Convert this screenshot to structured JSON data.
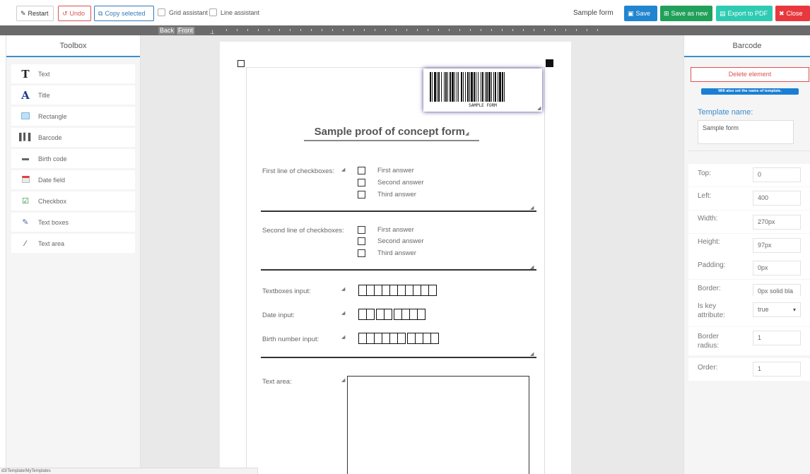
{
  "toolbar": {
    "restart_label": "Restart",
    "undo_label": "Undo",
    "copy_label": "Copy selected",
    "grid_assistant_label": "Grid assistant",
    "line_assistant_label": "Line assistant",
    "form_name": "Sample form",
    "save_label": "Save",
    "save_as_new_label": "Save as new",
    "export_label": "Export to PDF",
    "close_label": "Close"
  },
  "ruler": {
    "back_label": "Back",
    "front_label": "Front"
  },
  "toolbox": {
    "title": "Toolbox",
    "items": [
      {
        "label": "Text",
        "icon": "text-icon"
      },
      {
        "label": "Title",
        "icon": "title-icon"
      },
      {
        "label": "Rectangle",
        "icon": "rectangle-icon"
      },
      {
        "label": "Barcode",
        "icon": "barcode-icon"
      },
      {
        "label": "Birth code",
        "icon": "birth-code-icon"
      },
      {
        "label": "Date field",
        "icon": "calendar-icon"
      },
      {
        "label": "Checkbox",
        "icon": "checkbox-icon"
      },
      {
        "label": "Text boxes",
        "icon": "text-boxes-icon"
      },
      {
        "label": "Text area",
        "icon": "text-area-icon"
      }
    ]
  },
  "form": {
    "barcode_text": "SAMPLE FORM",
    "title": "Sample proof of concept form",
    "checkbox_group_1": {
      "label": "First line of checkboxes:",
      "options": [
        "First answer",
        "Second answer",
        "Third answer"
      ]
    },
    "checkbox_group_2": {
      "label": "Second line of checkboxes:",
      "options": [
        "First answer",
        "Second answer",
        "Third answer"
      ]
    },
    "textboxes_label": "Textboxes input:",
    "date_label": "Date input:",
    "birth_number_label": "Birth number input:",
    "text_area_label": "Text area:"
  },
  "properties": {
    "title": "Barcode",
    "delete_label": "Delete element",
    "note": "Will also set the name of template.",
    "template_name_label": "Template name:",
    "template_name_value": "Sample form",
    "rows": [
      {
        "label": "Top:",
        "value": "0"
      },
      {
        "label": "Left:",
        "value": "400"
      },
      {
        "label": "Width:",
        "value": "270px"
      },
      {
        "label": "Height:",
        "value": "97px"
      },
      {
        "label": "Padding:",
        "value": "0px"
      },
      {
        "label": "Border:",
        "value": "0px solid bla"
      },
      {
        "label": "Is key attribute:",
        "value": "true"
      },
      {
        "label": "Border radius:",
        "value": "1"
      },
      {
        "label": "Order:",
        "value": "1"
      }
    ]
  },
  "status_url": "d3/Template/MyTemplates"
}
